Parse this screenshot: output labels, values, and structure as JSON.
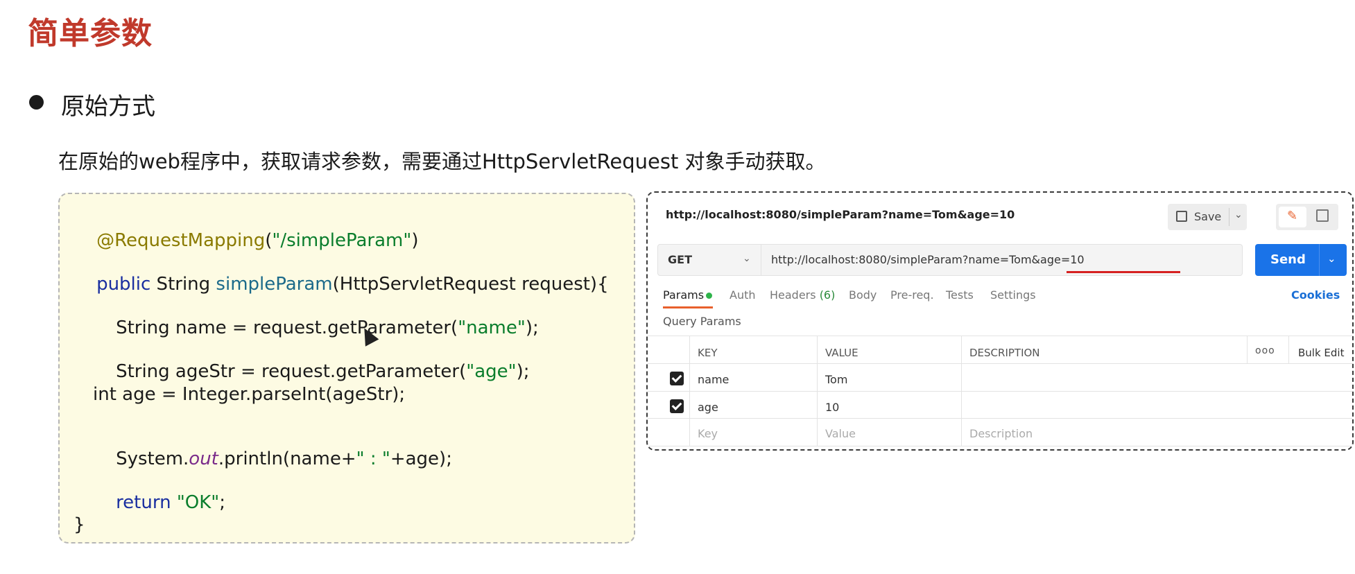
{
  "page": {
    "title": "简单参数",
    "bullet": "原始方式",
    "description": "在原始的web程序中，获取请求参数，需要通过HttpServletRequest 对象手动获取。"
  },
  "code": {
    "line1_annotation": "@RequestMapping",
    "line1_paren_open": "(",
    "line1_string": "\"/simpleParam\"",
    "line1_paren_close": ")",
    "line2_keyword": "public",
    "line2_type": " String ",
    "line2_method": "simpleParam",
    "line2_rest": "(HttpServletRequest request){",
    "line3_pre": "String name = request.getParameter(",
    "line3_string": "\"name\"",
    "line3_post": ");",
    "line4_pre": "String ageStr = request.getParameter(",
    "line4_string": "\"age\"",
    "line4_post": ");",
    "line5": "int age = Integer.parseInt(ageStr);",
    "line6_pre": "System.",
    "line6_italic": "out",
    "line6_mid": ".println(name+",
    "line6_string": "\" : \"",
    "line6_post": "+age);",
    "line7_keyword": "return",
    "line7_string": " \"OK\"",
    "line7_post": ";",
    "line8": "}"
  },
  "postman": {
    "request_title": "http://localhost:8080/simpleParam?name=Tom&age=10",
    "save_label": "Save",
    "method": "GET",
    "url": "http://localhost:8080/simpleParam?name=Tom&age=10",
    "send_label": "Send",
    "tabs": {
      "params": "Params",
      "auth": "Auth",
      "headers": "Headers",
      "headers_count": "(6)",
      "body": "Body",
      "prereq": "Pre-req.",
      "tests": "Tests",
      "settings": "Settings"
    },
    "cookies_label": "Cookies",
    "query_params_label": "Query Params",
    "table": {
      "col_key": "KEY",
      "col_value": "VALUE",
      "col_description": "DESCRIPTION",
      "more": "ooo",
      "bulk_edit": "Bulk Edit",
      "rows": [
        {
          "key": "name",
          "value": "Tom",
          "checked": true
        },
        {
          "key": "age",
          "value": "10",
          "checked": true
        }
      ],
      "placeholder_key": "Key",
      "placeholder_value": "Value",
      "placeholder_description": "Description"
    },
    "colors": {
      "send": "#1a73e8",
      "active_tab_underline": "#e8602c",
      "url_highlight": "#d62020",
      "params_dot": "#2eb34a"
    }
  }
}
